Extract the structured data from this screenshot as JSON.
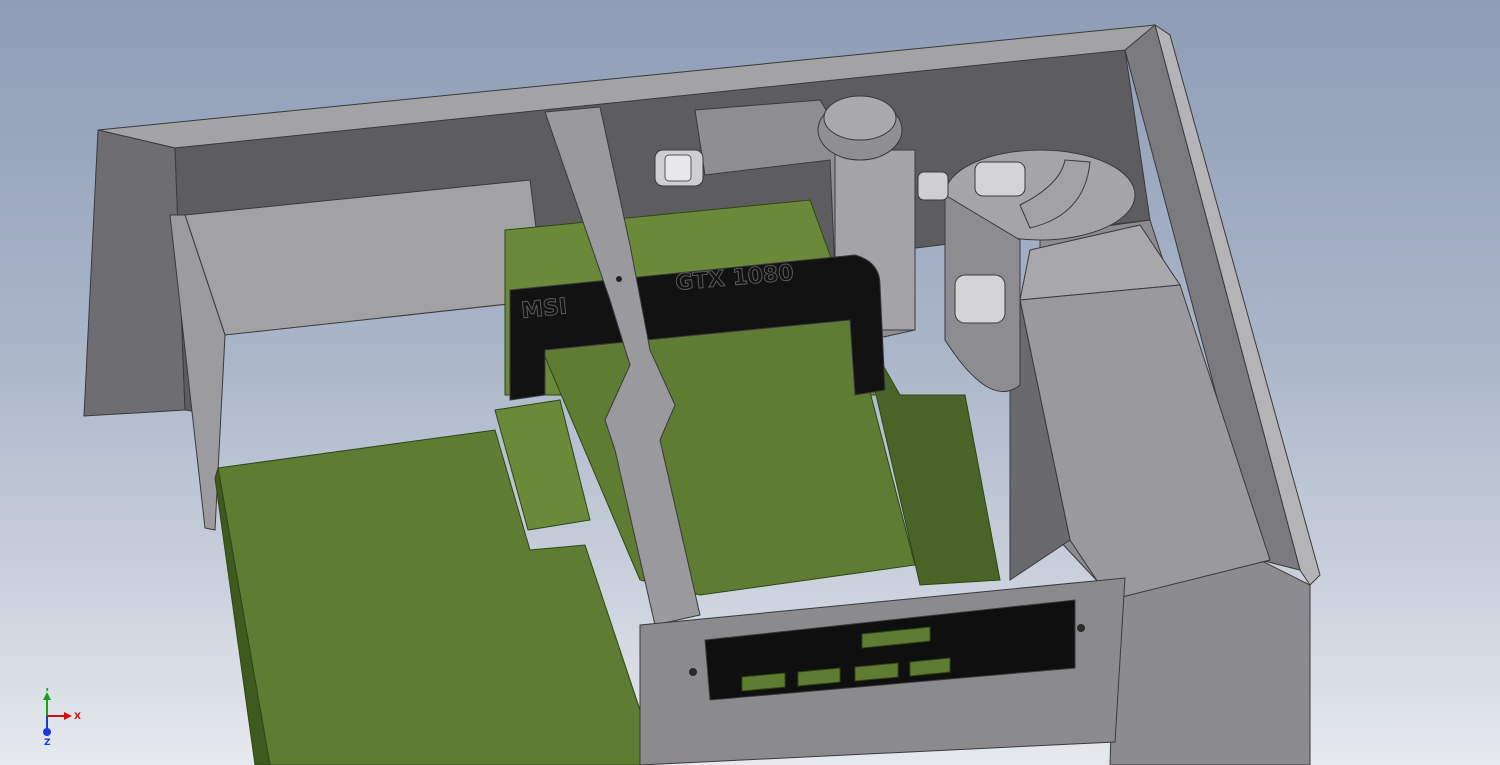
{
  "viewport": {
    "background_top": "#8e9db6",
    "background_bottom": "#e6e9ee"
  },
  "model": {
    "body_color": "#8b8b8e",
    "panel_dark": "#5a5a5d",
    "pcb_color": "#5f7a34",
    "pcb_shadow": "#3e5a1f",
    "bracket_color": "#111111",
    "bracket_text_left": "MSI",
    "bracket_text_right": "GTX 1080",
    "fitting_color": "#cfcfd2"
  },
  "triad": {
    "x_label": "X",
    "y_label": "Y",
    "z_label": "Z",
    "x_color": "#d01010",
    "y_color": "#16a316",
    "z_color": "#1a3bd6"
  }
}
